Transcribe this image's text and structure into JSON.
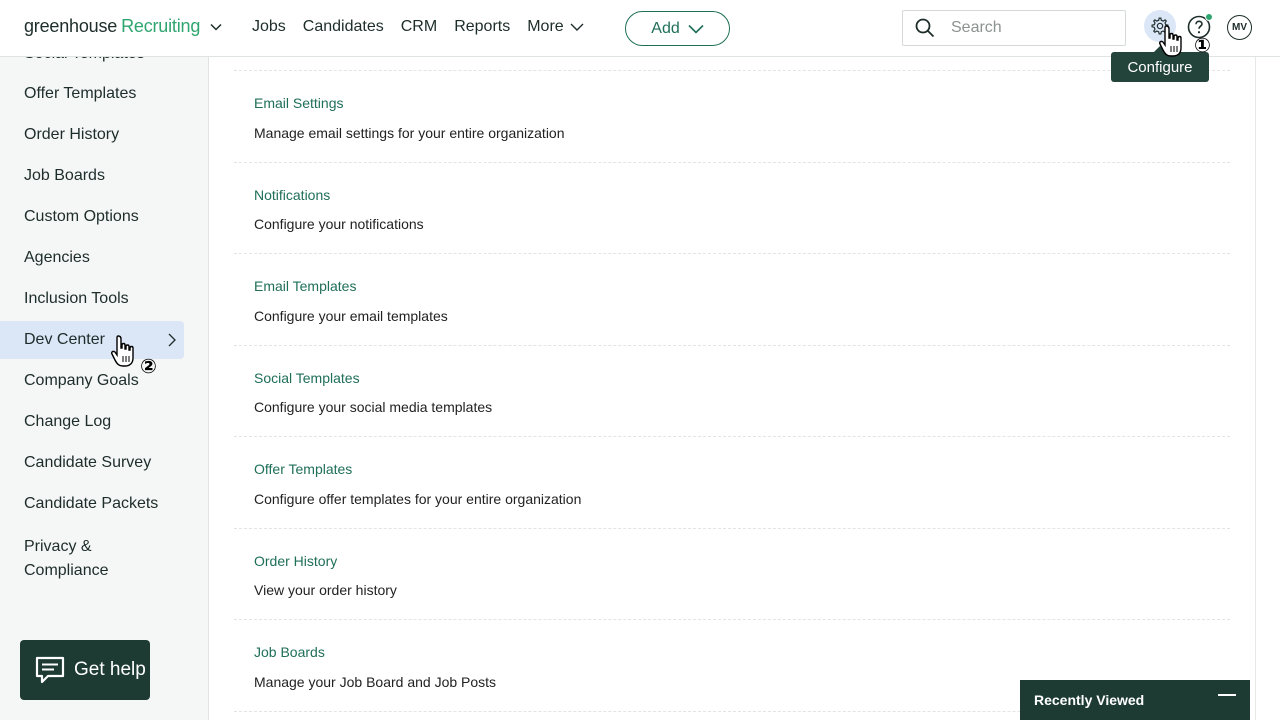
{
  "header": {
    "logo_primary": "greenhouse",
    "logo_secondary": "Recruiting",
    "nav": [
      "Jobs",
      "Candidates",
      "CRM",
      "Reports",
      "More"
    ],
    "add_label": "Add",
    "search_placeholder": "Search",
    "avatar_initials": "MV",
    "tooltip": "Configure"
  },
  "sidebar": {
    "partial_top": "Social Templates",
    "items": [
      "Offer Templates",
      "Order History",
      "Job Boards",
      "Custom Options",
      "Agencies",
      "Inclusion Tools",
      "Dev Center",
      "Company Goals",
      "Change Log",
      "Candidate Survey",
      "Candidate Packets"
    ],
    "privacy_line1": "Privacy &",
    "privacy_line2": "Compliance",
    "active_item": "Dev Center",
    "get_help": "Get help"
  },
  "settings": [
    {
      "title": "Email Settings",
      "desc": "Manage email settings for your entire organization"
    },
    {
      "title": "Notifications",
      "desc": "Configure your notifications"
    },
    {
      "title": "Email Templates",
      "desc": "Configure your email templates"
    },
    {
      "title": "Social Templates",
      "desc": "Configure your social media templates"
    },
    {
      "title": "Offer Templates",
      "desc": "Configure offer templates for your entire organization"
    },
    {
      "title": "Order History",
      "desc": "View your order history"
    },
    {
      "title": "Job Boards",
      "desc": "Manage your Job Board and Job Posts"
    }
  ],
  "recently_viewed": "Recently Viewed",
  "annotations": [
    "①",
    "②"
  ],
  "colors": {
    "brand_green": "#2fa56f",
    "link_green": "#1f6f58",
    "dark_panel": "#1d3b33",
    "active_blue": "#dbe6f7"
  }
}
